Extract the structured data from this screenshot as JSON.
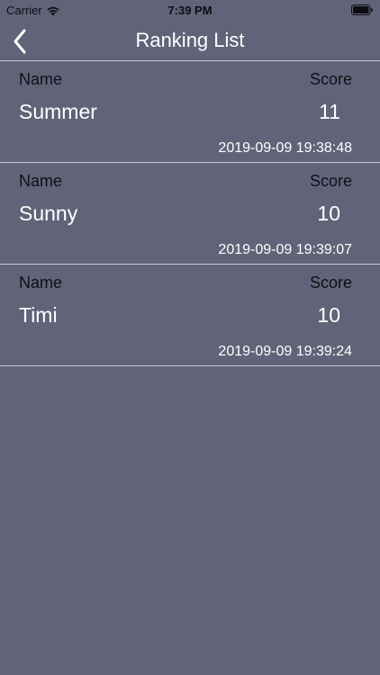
{
  "status_bar": {
    "carrier": "Carrier",
    "time": "7:39 PM"
  },
  "nav": {
    "title": "Ranking List"
  },
  "labels": {
    "name": "Name",
    "score": "Score"
  },
  "rankings": [
    {
      "name": "Summer",
      "score": "11",
      "time": "2019-09-09 19:38:48"
    },
    {
      "name": "Sunny",
      "score": "10",
      "time": "2019-09-09 19:39:07"
    },
    {
      "name": "Timi",
      "score": "10",
      "time": "2019-09-09 19:39:24"
    }
  ]
}
